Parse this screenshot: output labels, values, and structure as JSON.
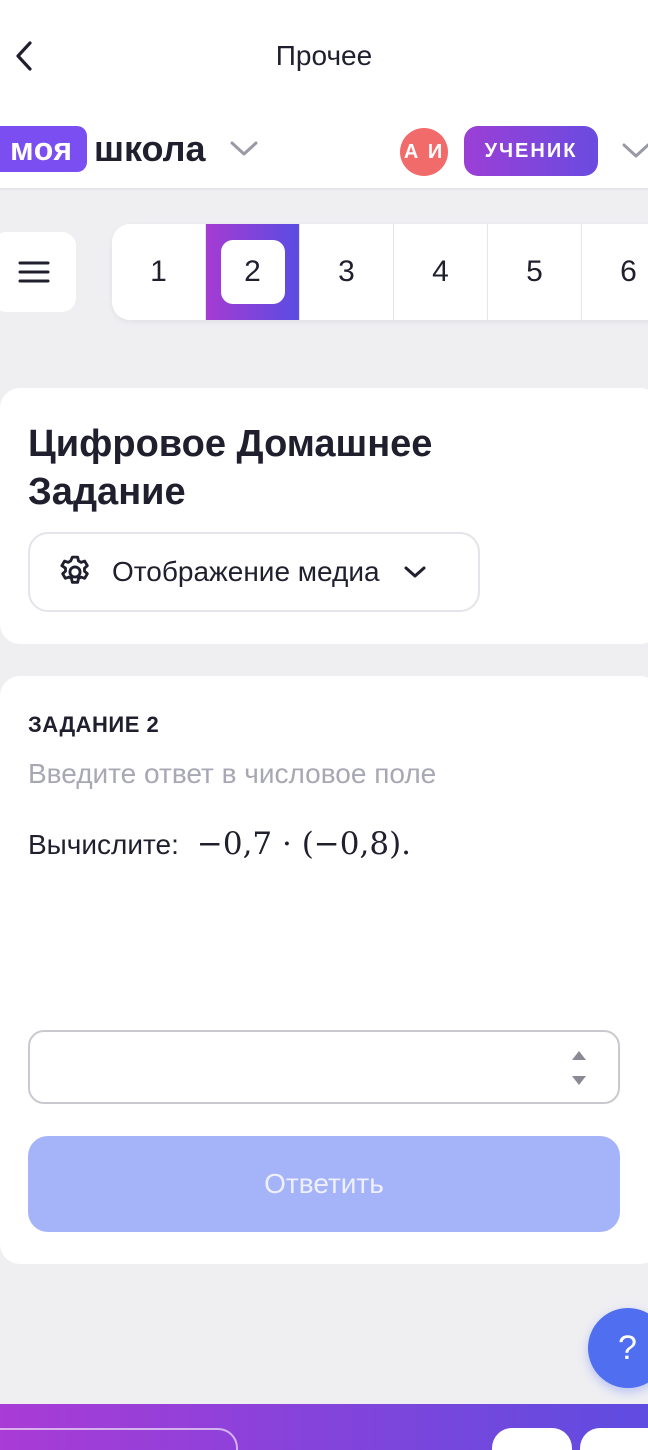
{
  "topbar": {
    "title": "Прочее"
  },
  "brand": {
    "part1": "моя",
    "part2": "школа"
  },
  "user": {
    "initials": "А И",
    "role": "УЧЕНИК"
  },
  "tasks": {
    "items": [
      "1",
      "2",
      "3",
      "4",
      "5",
      "6"
    ],
    "active": "2"
  },
  "header": {
    "title": "Цифровое Домашнее Задание",
    "media_label": "Отображение медиа"
  },
  "task": {
    "label": "ЗАДАНИЕ 2",
    "hint": "Введите ответ в числовое поле",
    "prompt": "Вычислите:",
    "expression": "−0,7 · (−0,8).",
    "input_value": "",
    "submit_label": "Ответить"
  },
  "help": {
    "label": "?"
  },
  "colors": {
    "accent": "#7a4ef0",
    "avatar": "#f26b6b",
    "submit_disabled": "#a5b4f8",
    "help": "#4f6ef0"
  }
}
